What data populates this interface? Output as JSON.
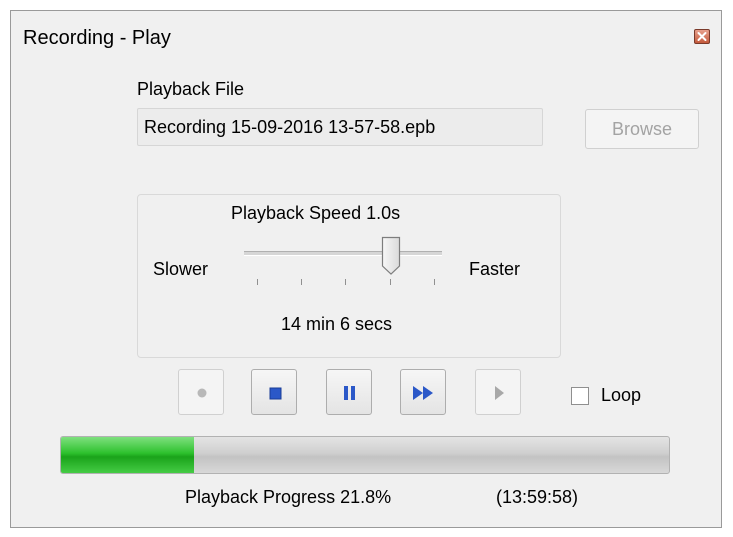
{
  "window": {
    "title": "Recording - Play"
  },
  "playback_file": {
    "label": "Playback File",
    "value": "Recording 15-09-2016 13-57-58.epb",
    "browse_label": "Browse"
  },
  "speed": {
    "title": "Playback Speed  1.0s",
    "slower_label": "Slower",
    "faster_label": "Faster",
    "duration": "14 min 6 secs",
    "slider_position": 0.7
  },
  "transport": {
    "record": "record-icon",
    "stop": "stop-icon",
    "pause": "pause-icon",
    "fast_forward": "fast-forward-icon",
    "play": "play-icon"
  },
  "loop": {
    "label": "Loop",
    "checked": false
  },
  "progress": {
    "label": "Playback Progress  21.8%",
    "time": "(13:59:58)",
    "fraction": 0.218
  },
  "colors": {
    "window_bg": "#f0f0f0",
    "progress_green": "#2dc12d",
    "transport_blue": "#2b58c8"
  }
}
